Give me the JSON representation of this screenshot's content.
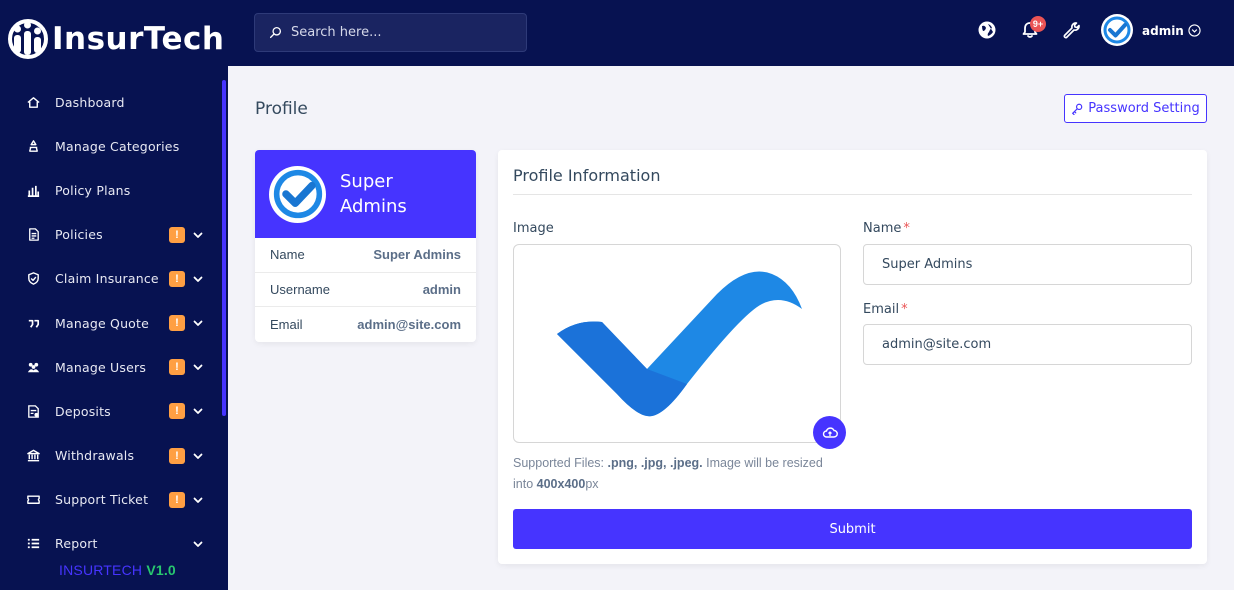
{
  "brand": {
    "logo_text": "InsurTech",
    "version_name": "INSURTECH",
    "version_number": "V1.0",
    "accent": "#4634ff",
    "sidebar_bg": "#071251",
    "warning": "#ff9f43",
    "danger": "#ea5455",
    "success": "#28c76f"
  },
  "sidebar": {
    "items": [
      {
        "label": "Dashboard",
        "icon": "home-icon",
        "badge": "",
        "chevron": false
      },
      {
        "label": "Manage Categories",
        "icon": "categories-icon",
        "badge": "",
        "chevron": false
      },
      {
        "label": "Policy Plans",
        "icon": "bar-chart-icon",
        "badge": "",
        "chevron": false
      },
      {
        "label": "Policies",
        "icon": "document-icon",
        "badge": "!",
        "chevron": true
      },
      {
        "label": "Claim Insurance",
        "icon": "shield-icon",
        "badge": "!",
        "chevron": true
      },
      {
        "label": "Manage Quote",
        "icon": "quote-icon",
        "badge": "!",
        "chevron": true
      },
      {
        "label": "Manage Users",
        "icon": "users-icon",
        "badge": "!",
        "chevron": true
      },
      {
        "label": "Deposits",
        "icon": "deposit-icon",
        "badge": "!",
        "chevron": true
      },
      {
        "label": "Withdrawals",
        "icon": "bank-icon",
        "badge": "!",
        "chevron": true
      },
      {
        "label": "Support Ticket",
        "icon": "ticket-icon",
        "badge": "!",
        "chevron": true
      },
      {
        "label": "Report",
        "icon": "list-icon",
        "badge": "",
        "chevron": true
      }
    ]
  },
  "topbar": {
    "search_placeholder": "Search here...",
    "notification_count": "9+",
    "admin_name": "admin"
  },
  "main": {
    "page_title": "Profile",
    "password_button": "Password Setting",
    "profile_card": {
      "display_name": "Super Admins",
      "rows": [
        {
          "key": "Name",
          "value": "Super Admins"
        },
        {
          "key": "Username",
          "value": "admin"
        },
        {
          "key": "Email",
          "value": "admin@site.com"
        }
      ]
    },
    "form": {
      "title": "Profile Information",
      "image_label": "Image",
      "name_label": "Name",
      "name_value": "Super Admins",
      "email_label": "Email",
      "email_value": "admin@site.com",
      "required_mark": "*",
      "help_prefix": "Supported Files: ",
      "help_formats": ".png, .jpg, .jpeg.",
      "help_middle": " Image will be resized into ",
      "help_size": "400x400",
      "help_suffix": "px",
      "submit_label": "Submit"
    }
  }
}
